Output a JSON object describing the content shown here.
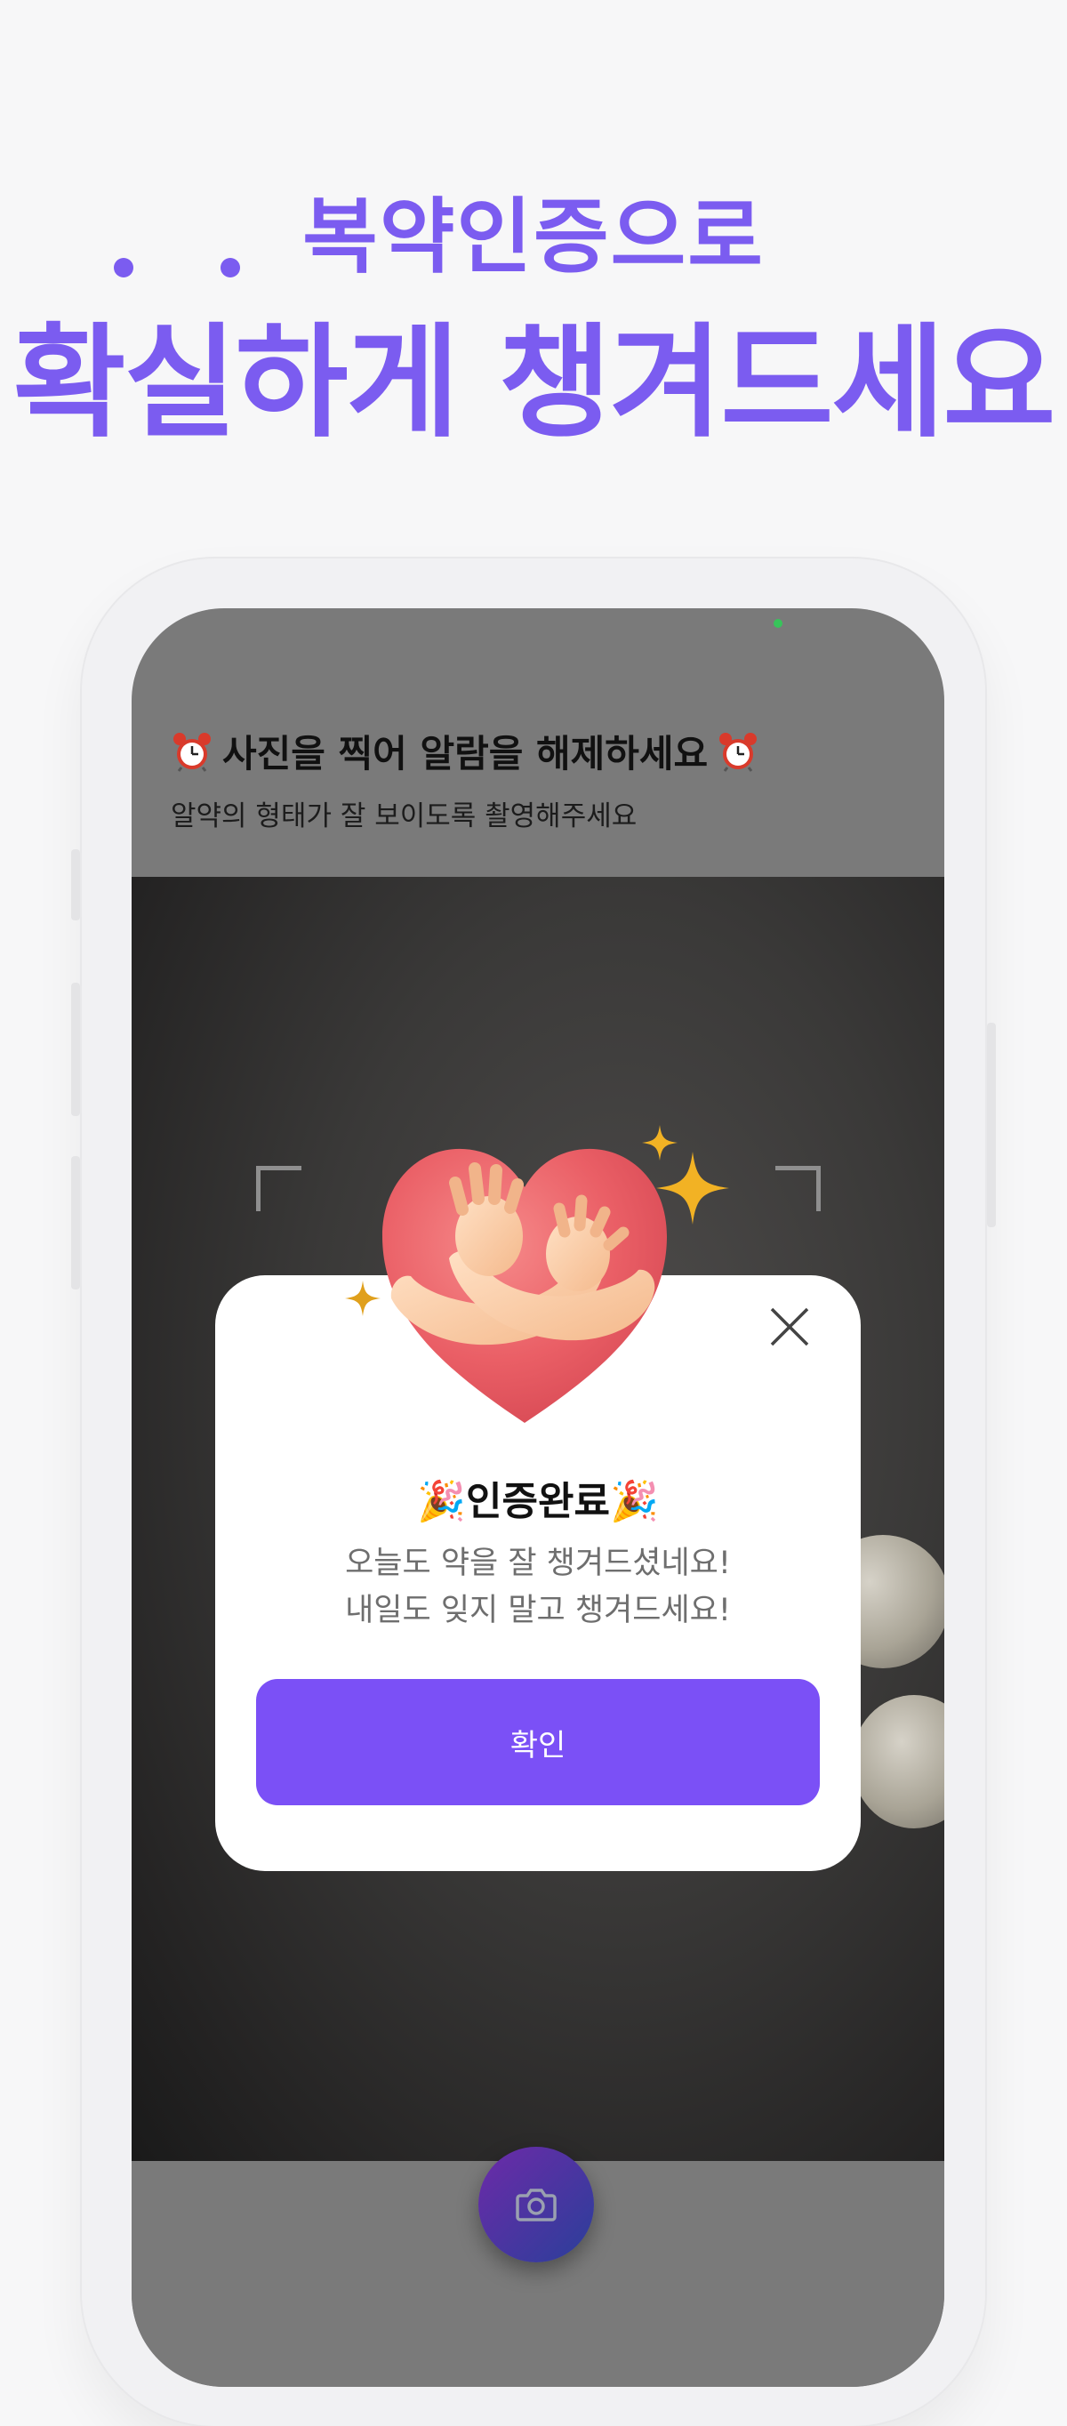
{
  "headline": {
    "subtitle": "복약인증으로",
    "title": "확실하게 챙겨드세요"
  },
  "alarm_screen": {
    "title": "사진을 찍어 알람을 해제하세요",
    "subtitle": "알약의 형태가 잘 보이도록 촬영해주세요",
    "title_icon": "alarm-clock-icon"
  },
  "dialog": {
    "title": "🎉인증완료🎉",
    "message_line1": "오늘도 약을 잘 챙겨드셨네요!",
    "message_line2": "내일도 잊지 말고 챙겨드세요!",
    "confirm_label": "확인",
    "close_icon": "close-icon",
    "illustration": "heart-hug-icon"
  },
  "camera": {
    "shutter_icon": "camera-icon"
  },
  "colors": {
    "brand": "#7b5cf0",
    "button": "#7b50f6",
    "status_green": "#37c45a"
  }
}
